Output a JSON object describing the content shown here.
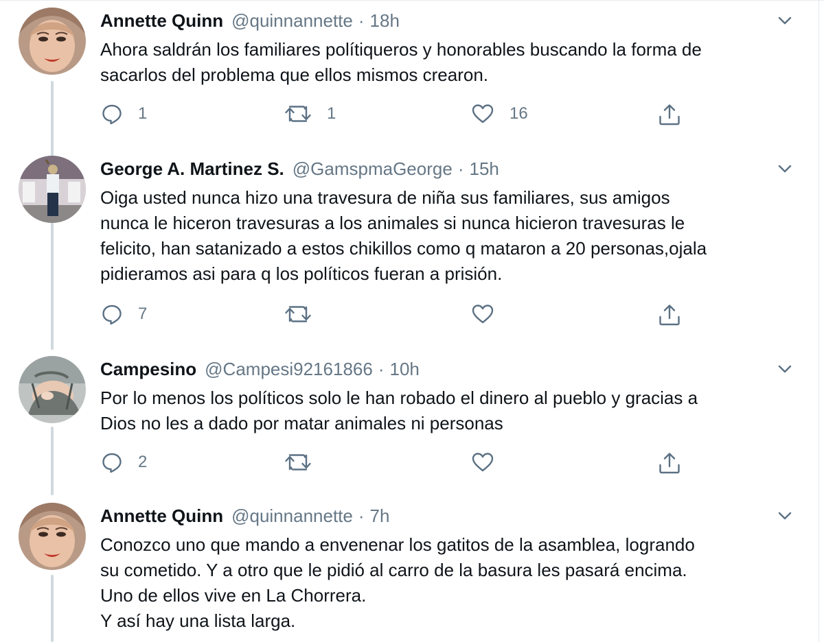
{
  "tweets": [
    {
      "name": "Annette Quinn",
      "handle": "@quinnannette",
      "separator": "·",
      "time": "18h",
      "lines": [
        "Ahora saldrán los familiares polítiqueros y honorables buscando la forma de",
        "sacarlos del problema que ellos mismos crearon."
      ],
      "reply_count": "1",
      "retweet_count": "1",
      "like_count": "16"
    },
    {
      "name": "George A. Martinez S.",
      "handle": "@GamspmaGeorge",
      "separator": "·",
      "time": "15h",
      "lines": [
        "Oiga usted nunca hizo una travesura de niña sus familiares, sus amigos",
        "nunca le hiceron travesuras a los animales si nunca hicieron travesuras le",
        "felicito, han satanizado a estos chikillos como q mataron a 20 personas,ojala",
        "pidieramos asi para q los políticos fueran a prisión."
      ],
      "reply_count": "7",
      "retweet_count": "",
      "like_count": ""
    },
    {
      "name": "Campesino",
      "handle": "@Campesi92161866",
      "separator": "·",
      "time": "10h",
      "lines": [
        "Por lo menos los políticos solo le han robado el dinero al pueblo y gracias a",
        "Dios no les a dado por matar animales ni personas"
      ],
      "reply_count": "2",
      "retweet_count": "",
      "like_count": ""
    },
    {
      "name": "Annette Quinn",
      "handle": "@quinnannette",
      "separator": "·",
      "time": "7h",
      "lines": [
        "Conozco uno que mando a envenenar los gatitos de la asamblea, logrando",
        "su cometido. Y a otro que le pidió al carro de la basura les pasará encima.",
        "Uno de ellos vive en La Chorrera.",
        "Y así hay una lista larga."
      ]
    }
  ],
  "icons": {
    "reply": "reply-icon",
    "retweet": "retweet-icon",
    "like": "like-icon",
    "share": "share-icon",
    "more": "chevron-down-icon"
  },
  "colors": {
    "text": "#0f1419",
    "secondary": "#657786",
    "icon": "#5b7083",
    "thread_line": "#cfd9de"
  }
}
